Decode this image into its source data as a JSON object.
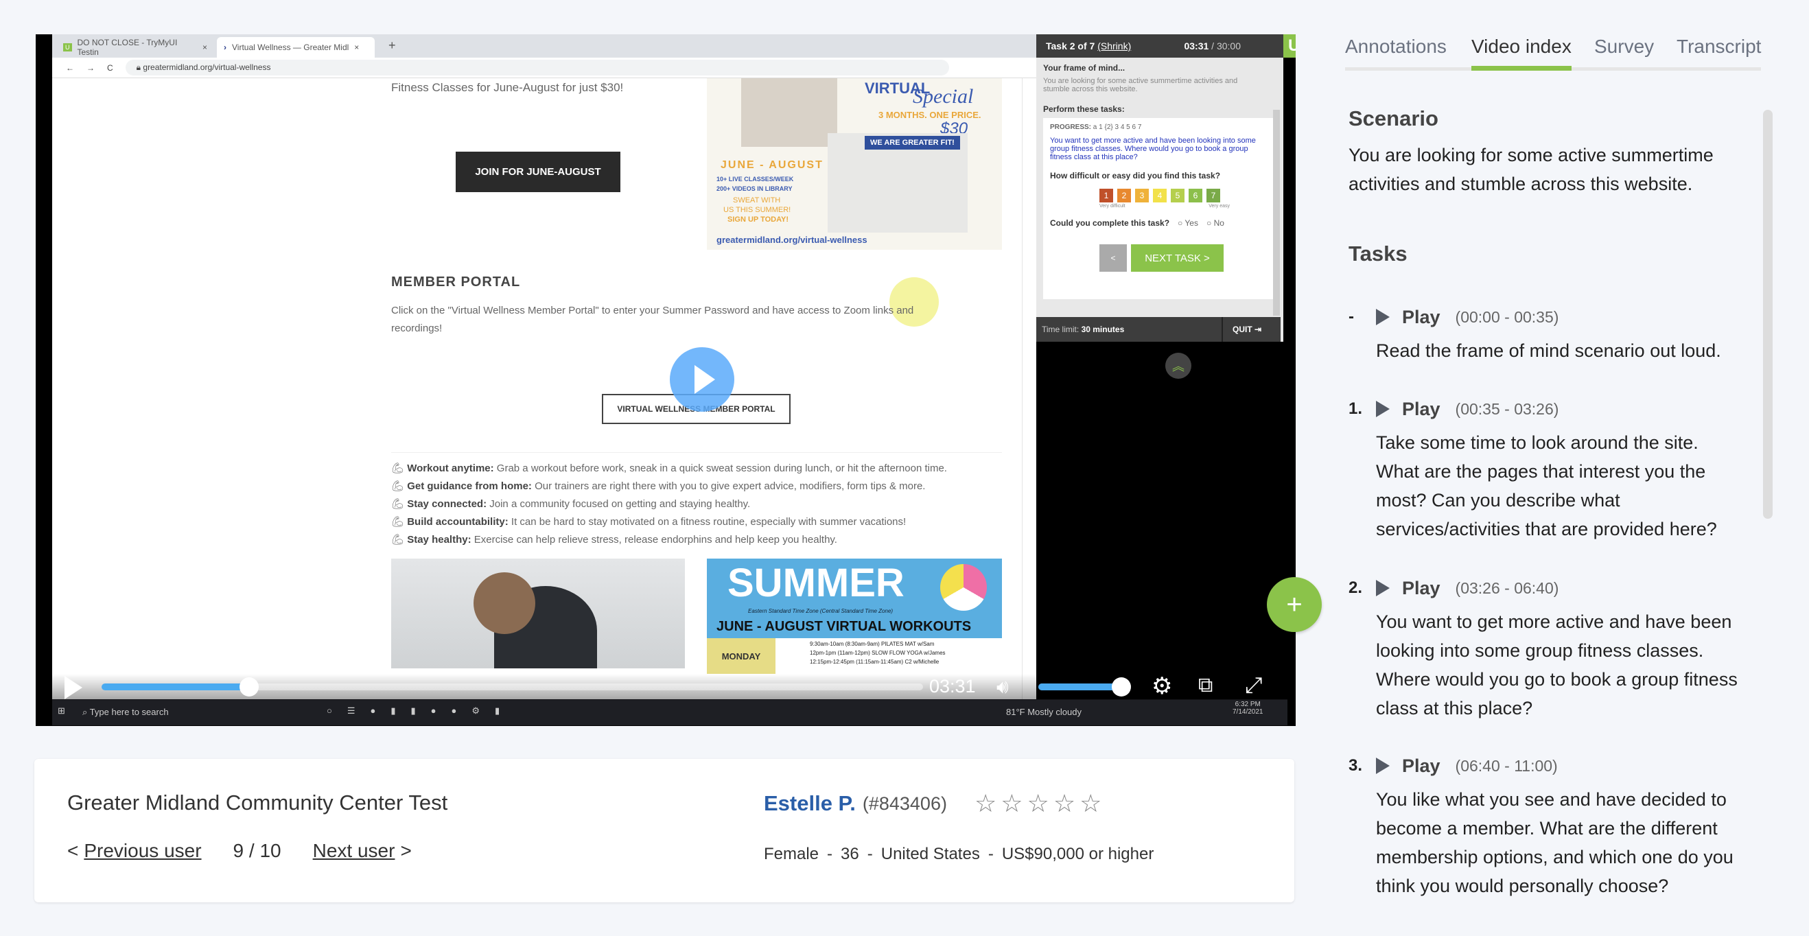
{
  "video": {
    "browser": {
      "tabs": [
        {
          "label": "DO NOT CLOSE - TryMyUI Testin",
          "active": false
        },
        {
          "label": "Virtual Wellness — Greater Midl",
          "active": true
        }
      ],
      "new_tab": "+",
      "url": "greatermidland.org/virtual-wellness"
    },
    "site": {
      "intro": "Fitness Classes for June-August for just $30!",
      "join_button": "JOIN FOR JUNE-AUGUST",
      "promo": {
        "title1": "VIRTUAL",
        "title2": "Special",
        "price_line": "3 MONTHS. ONE PRICE.",
        "price": "$30",
        "badge": "WE ARE GREATER FIT!",
        "dates": "JUNE - AUGUST",
        "line1": "10+ LIVE CLASSES/WEEK",
        "line2": "200+ VIDEOS IN LIBRARY",
        "cta1": "SWEAT WITH",
        "cta2": "US THIS SUMMER!",
        "cta3": "SIGN UP TODAY!",
        "url": "greatermidland.org/virtual-wellness"
      },
      "member_portal_heading": "MEMBER PORTAL",
      "member_portal_text1": "Click on the \"Virtual Wellness Member Portal\" to enter your Summer Password and have access to Zoom links and",
      "member_portal_text2": "recordings!",
      "portal_button": "VIRTUAL WELLNESS MEMBER PORTAL",
      "bullets": [
        {
          "bold": "Workout anytime:",
          "text": " Grab a workout before work, sneak in a quick sweat session during lunch, or hit the afternoon time."
        },
        {
          "bold": "Get guidance from home:",
          "text": " Our trainers are right there with you to give expert advice, modifiers, form tips & more."
        },
        {
          "bold": "Stay connected:",
          "text": " Join a community focused on getting and staying healthy."
        },
        {
          "bold": "Build accountability:",
          "text": " It can be hard to stay motivated on a fitness routine, especially with summer vacations!"
        },
        {
          "bold": "Stay healthy:",
          "text": " Exercise can help relieve stress, release endorphins and help keep you healthy."
        }
      ],
      "summer": {
        "title": "SUMMER",
        "tz": "Eastern Standard Time Zone (Central Standard Time Zone)",
        "subtitle": "JUNE - AUGUST VIRTUAL WORKOUTS",
        "day": "MONDAY",
        "classes": [
          "9:30am-10am (8:30am-9am) PILATES MAT w/Sam",
          "12pm-1pm (11am-12pm) SLOW FLOW YOGA w/James",
          "12:15pm-12:45pm (11:15am-11:45am) C2 w/Michelle"
        ]
      }
    },
    "task_panel": {
      "task_label": "Task 2 of 7",
      "shrink": "(Shrink)",
      "elapsed": "03:31",
      "limit": "/ 30:00",
      "logo": "UI",
      "frame_heading": "Your frame of mind...",
      "frame_text": "You are looking for some active summertime activities and stumble across this website.",
      "perform_heading": "Perform these tasks:",
      "progress_label": "PROGRESS:",
      "progress_steps": "a 1 {2} 3 4 5 6 7",
      "task_text": "You want to get more active and have been looking into some group fitness classes. Where would you go to book a group fitness class at this place?",
      "difficulty_q": "How difficult or easy did you find this task?",
      "ratings": [
        "1",
        "2",
        "3",
        "4",
        "5",
        "6",
        "7"
      ],
      "rating_colors": [
        "#c0502a",
        "#e8892f",
        "#efb23a",
        "#f2e14a",
        "#b5cf4d",
        "#8cbf4b",
        "#7aaa48"
      ],
      "very_difficult": "Very difficult",
      "very_easy": "Very easy",
      "complete_q": "Could you complete this task?",
      "yes": "Yes",
      "no": "No",
      "back": "<",
      "next": "NEXT TASK >",
      "time_limit_label": "Time limit:",
      "time_limit_value": "30 minutes",
      "quit": "QUIT"
    },
    "taskbar": {
      "search": "Type here to search",
      "weather": "81°F  Mostly cloudy",
      "time": "6:32 PM",
      "date": "7/14/2021"
    },
    "player": {
      "current_time": "03:31",
      "progress_fraction": 0.18,
      "volume_fraction": 1.0
    }
  },
  "card": {
    "test_title": "Greater Midland Community Center Test",
    "prev": "Previous user",
    "prev_arrow": "<",
    "position": "9 / 10",
    "next": "Next user",
    "next_arrow": ">",
    "user_name": "Estelle P.",
    "user_id": "(#843406)",
    "rating": 0,
    "rating_max": 5,
    "demographics": [
      "Female",
      "36",
      "United States",
      "US$90,000 or higher"
    ],
    "sep": "-"
  },
  "sidebar": {
    "tabs": [
      {
        "label": "Annotations"
      },
      {
        "label": "Video index",
        "active": true
      },
      {
        "label": "Survey"
      },
      {
        "label": "Transcript"
      }
    ],
    "accent": "#8bc34a",
    "scenario_heading": "Scenario",
    "scenario_text": "You are looking for some active summertime activities and stumble across this website.",
    "tasks_heading": "Tasks",
    "tasks": [
      {
        "num": "-",
        "play": "Play",
        "time": "(00:00 - 00:35)",
        "desc": "Read the frame of mind scenario out loud."
      },
      {
        "num": "1.",
        "play": "Play",
        "time": "(00:35 - 03:26)",
        "desc": "Take some time to look around the site. What are the pages that interest you the most? Can you describe what services/activities that are provided here?"
      },
      {
        "num": "2.",
        "play": "Play",
        "time": "(03:26 - 06:40)",
        "desc": "You want to get more active and have been looking into some group fitness classes. Where would you go to book a group fitness class at this place?"
      },
      {
        "num": "3.",
        "play": "Play",
        "time": "(06:40 - 11:00)",
        "desc": "You like what you see and have decided to become a member. What are the different membership options, and which one do you think you would personally choose?"
      }
    ]
  }
}
